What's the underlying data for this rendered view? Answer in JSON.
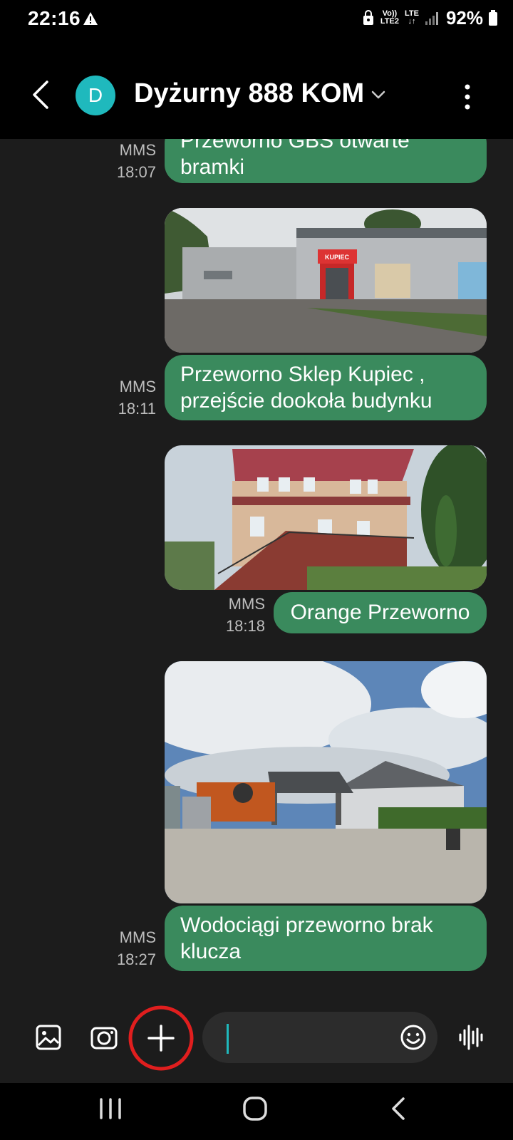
{
  "status_bar": {
    "time": "22:16",
    "network_line1": "Vo))",
    "network_line2": "LTE2",
    "lte_label": "LTE",
    "battery": "92%"
  },
  "header": {
    "avatar_letter": "D",
    "contact_name": "Dyżurny 888 KOM"
  },
  "messages": [
    {
      "type": "MMS",
      "time": "18:07",
      "line1": "Przeworno GBS  otwarte",
      "line2": "bramki"
    },
    {
      "type": "MMS",
      "time": "18:11",
      "line1": "Przeworno Sklep Kupiec  ,",
      "line2": "przejście dookoła budynku"
    },
    {
      "type": "MMS",
      "time": "18:18",
      "line1": "Orange Przeworno"
    },
    {
      "type": "MMS",
      "time": "18:27",
      "line1": "Wodociągi przeworno brak",
      "line2": "klucza"
    }
  ],
  "photo_texts": {
    "shop_sign": "KUPIEC"
  },
  "icons": {
    "status": [
      "warning-icon",
      "sim-lock-icon",
      "signal-icon",
      "battery-icon"
    ],
    "header": [
      "back-icon",
      "chevron-down-icon",
      "more-icon"
    ],
    "input_bar": [
      "gallery-icon",
      "camera-icon",
      "add-icon",
      "emoji-icon",
      "voice-icon"
    ],
    "nav": [
      "recents-icon",
      "home-icon",
      "nav-back-icon"
    ]
  },
  "colors": {
    "bubble": "#3a8a5d",
    "avatar": "#1fb9bd",
    "highlight_circle": "#e01e1e"
  }
}
